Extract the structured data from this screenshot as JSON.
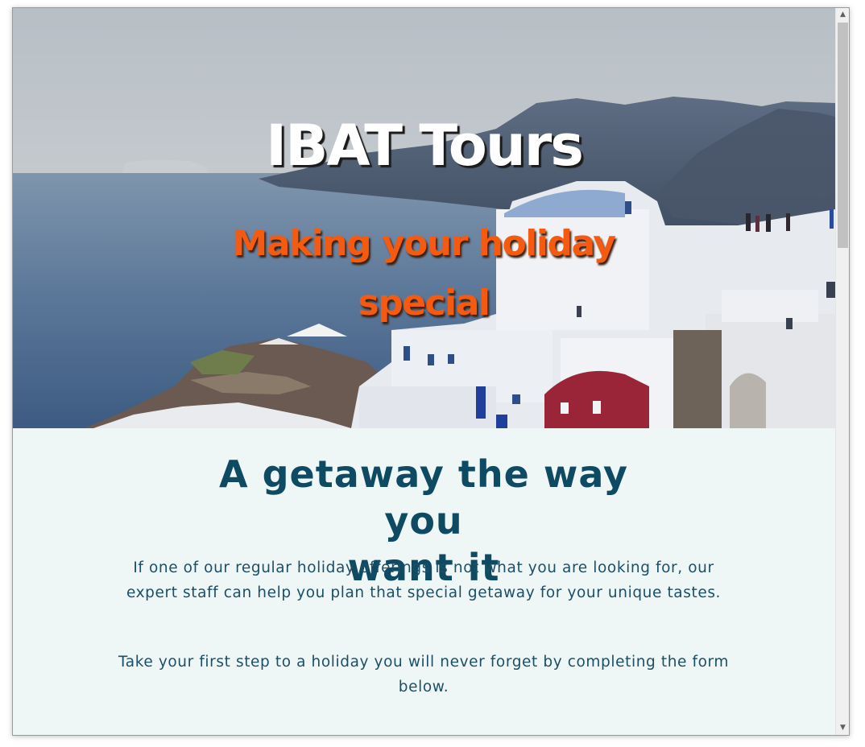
{
  "hero": {
    "title": "IBAT Tours",
    "subtitle_line1": "Making your holiday",
    "subtitle_line2": "special"
  },
  "intro": {
    "heading_line1": "A getaway the way you",
    "heading_line2": "want it",
    "paragraph1": "If one of our regular holiday offerings is not what you are looking for, our expert staff can help you plan that special getaway for your unique tastes.",
    "paragraph2": "Take your first step to a holiday you will never forget by completing the form below."
  },
  "scrollbar": {
    "up_icon": "chevron-up-icon",
    "down_icon": "chevron-down-icon"
  },
  "colors": {
    "title": "#ffffff",
    "subtitle": "#f45a10",
    "heading": "#0f4a63",
    "body_text": "#1c4f66",
    "content_background": "#eef7f5"
  }
}
